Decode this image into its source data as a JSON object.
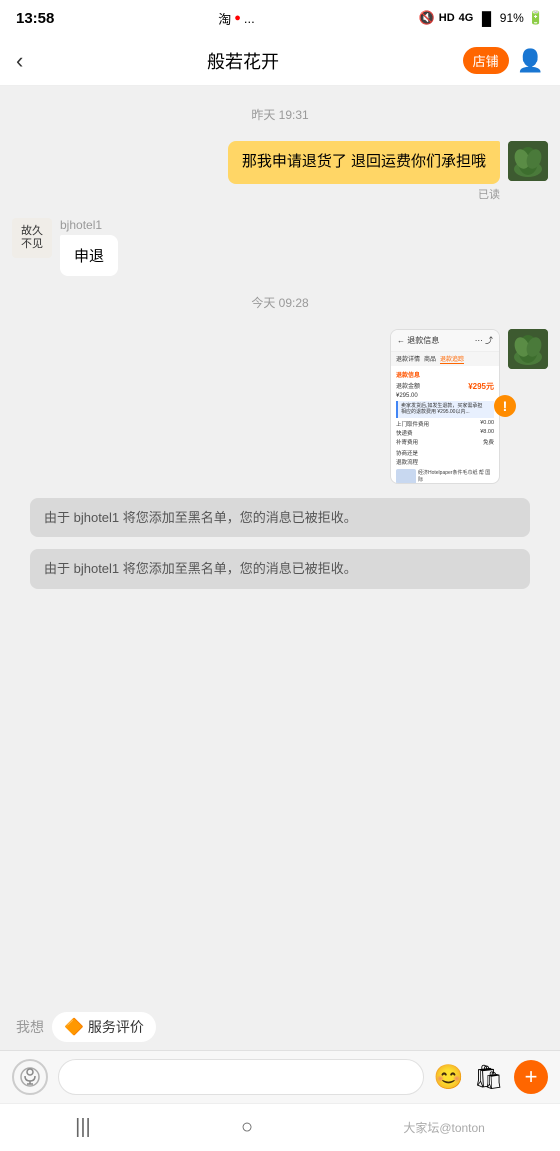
{
  "status_bar": {
    "time": "13:58",
    "icons": "🔇 HD 4G ▐▐▐▌ 91% 🔋",
    "apps": "淘 🔴 ..."
  },
  "top_nav": {
    "back_label": "‹",
    "title": "般若花开",
    "shop_label": "店铺",
    "person_icon": "👤"
  },
  "chat": {
    "timestamp1": "昨天 19:31",
    "sent_msg1": "那我申请退货了 退回运费你们承担哦",
    "read_status": "已读",
    "received_sender": "bjhotel1",
    "received_card_label": "申退",
    "timestamp2": "今天 09:28",
    "system_msg1": "由于 bjhotel1 将您添加至黑名单，您的消息已被拒收。",
    "system_msg2": "由于 bjhotel1 将您添加至黑名单，您的消息已被拒收。"
  },
  "suggestion": {
    "label": "我想",
    "chip_emoji": "🔶",
    "chip_label": "服务评价"
  },
  "input_bar": {
    "placeholder": "",
    "voice_icon": "◎",
    "emoji_icon": "😊",
    "bag_icon": "🛍",
    "plus_icon": "+"
  },
  "bottom_nav": {
    "item1": "|||",
    "item2": "○",
    "watermark": "大家坛@tonton"
  },
  "screenshot": {
    "header": "← 退款信息",
    "nav_tabs": "退款详情  商品  退款追踪",
    "orange_label": "退款信息",
    "price1_label": "退款金额",
    "price1_value": "¥295元",
    "price2_label": "",
    "price2_value": "¥295.00",
    "blue_text": "卖家发货后,如发生退款,买家需承担相应的退款费用 ¥295.00以内买家可以协...",
    "fee_label1": "上门取件费用",
    "fee_value1": "¥0.00",
    "fee_label2": "快递费",
    "fee_value2": "¥8.00",
    "fee_label3": "补寄费用",
    "fee_value3": "免费",
    "bottom_label": "协商还是",
    "refund_label": "退款流程"
  }
}
